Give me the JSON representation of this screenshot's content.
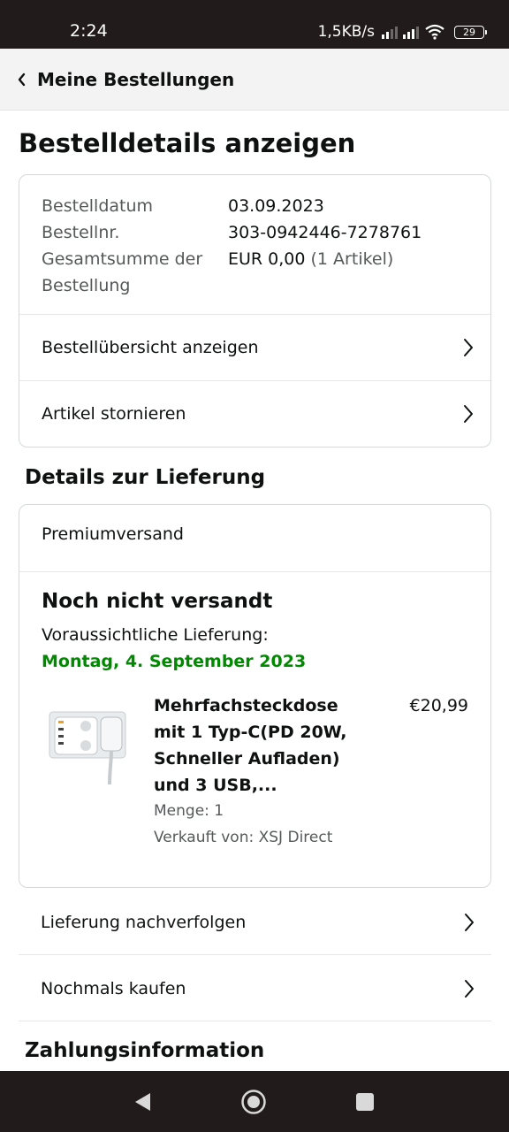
{
  "status_bar": {
    "time": "2:24",
    "network_speed": "1,5KB/s",
    "battery_level": "29"
  },
  "header": {
    "back_label": "Meine Bestellungen"
  },
  "page_title": "Bestelldetails anzeigen",
  "order_summary": {
    "rows": [
      {
        "label": "Bestelldatum",
        "value": "03.09.2023"
      },
      {
        "label": "Bestellnr.",
        "value": "303-0942446-7278761"
      }
    ],
    "total_label": "Gesamtsumme der Bestellung",
    "total_value": "EUR 0,00",
    "total_items": "(1 Artikel)",
    "links": [
      {
        "label": "Bestellübersicht anzeigen"
      },
      {
        "label": "Artikel stornieren"
      }
    ]
  },
  "delivery": {
    "section_title": "Details zur Lieferung",
    "shipping_method": "Premiumversand",
    "status": "Noch nicht versandt",
    "eta_label": "Voraussichtliche Lieferung:",
    "eta_date": "Montag, 4. September 2023",
    "product": {
      "title": "Mehrfachsteckdose mit 1 Typ-C(PD 20W, Schneller Aufladen) und 3 USB,...",
      "price": "€20,99",
      "quantity": "Menge: 1",
      "seller": "Verkauft von: XSJ Direct"
    }
  },
  "actions": [
    {
      "label": "Lieferung nachverfolgen"
    },
    {
      "label": "Nochmals kaufen"
    }
  ],
  "payment_section_title": "Zahlungsinformation",
  "colors": {
    "status_bar_bg": "#211c1b",
    "header_bg": "#f3f3f3",
    "delivery_green": "#008a00",
    "secondary_text": "#565959"
  }
}
